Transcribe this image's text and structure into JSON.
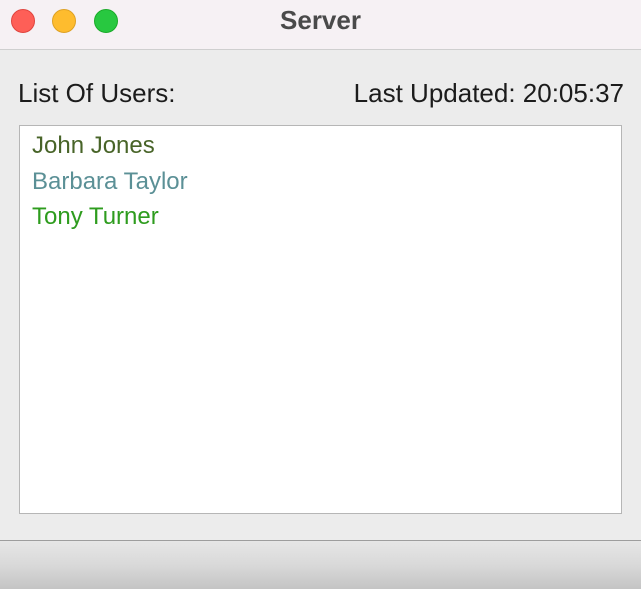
{
  "window": {
    "title": "Server",
    "controls": {
      "close_color": "#fe5f57",
      "minimize_color": "#febc2e",
      "zoom_color": "#28c840"
    }
  },
  "header": {
    "list_label": "List Of Users:",
    "last_updated": "Last Updated: 20:05:37"
  },
  "users": [
    {
      "name": "John Jones",
      "color": "#486428"
    },
    {
      "name": "Barbara Taylor",
      "color": "#5b9096"
    },
    {
      "name": "Tony Turner",
      "color": "#2e9c1e"
    }
  ]
}
